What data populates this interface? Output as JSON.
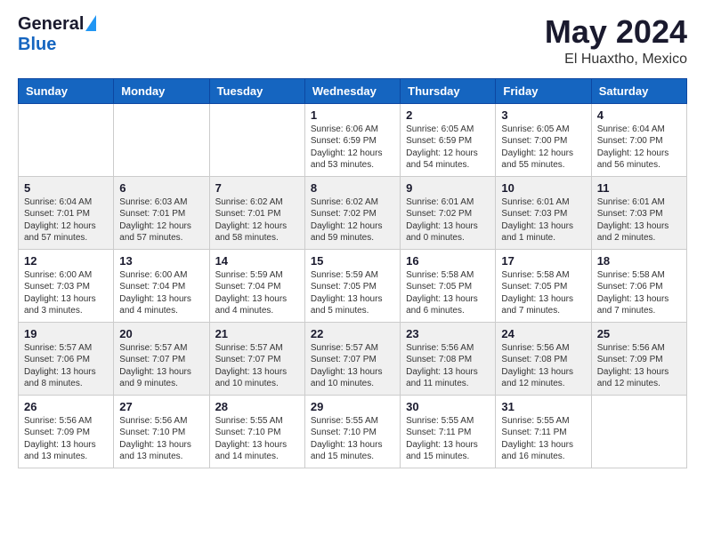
{
  "logo": {
    "general": "General",
    "blue": "Blue"
  },
  "header": {
    "month_year": "May 2024",
    "location": "El Huaxtho, Mexico"
  },
  "days_of_week": [
    "Sunday",
    "Monday",
    "Tuesday",
    "Wednesday",
    "Thursday",
    "Friday",
    "Saturday"
  ],
  "weeks": [
    [
      {
        "day": null,
        "info": ""
      },
      {
        "day": null,
        "info": ""
      },
      {
        "day": null,
        "info": ""
      },
      {
        "day": "1",
        "info": "Sunrise: 6:06 AM\nSunset: 6:59 PM\nDaylight: 12 hours\nand 53 minutes."
      },
      {
        "day": "2",
        "info": "Sunrise: 6:05 AM\nSunset: 6:59 PM\nDaylight: 12 hours\nand 54 minutes."
      },
      {
        "day": "3",
        "info": "Sunrise: 6:05 AM\nSunset: 7:00 PM\nDaylight: 12 hours\nand 55 minutes."
      },
      {
        "day": "4",
        "info": "Sunrise: 6:04 AM\nSunset: 7:00 PM\nDaylight: 12 hours\nand 56 minutes."
      }
    ],
    [
      {
        "day": "5",
        "info": "Sunrise: 6:04 AM\nSunset: 7:01 PM\nDaylight: 12 hours\nand 57 minutes."
      },
      {
        "day": "6",
        "info": "Sunrise: 6:03 AM\nSunset: 7:01 PM\nDaylight: 12 hours\nand 57 minutes."
      },
      {
        "day": "7",
        "info": "Sunrise: 6:02 AM\nSunset: 7:01 PM\nDaylight: 12 hours\nand 58 minutes."
      },
      {
        "day": "8",
        "info": "Sunrise: 6:02 AM\nSunset: 7:02 PM\nDaylight: 12 hours\nand 59 minutes."
      },
      {
        "day": "9",
        "info": "Sunrise: 6:01 AM\nSunset: 7:02 PM\nDaylight: 13 hours\nand 0 minutes."
      },
      {
        "day": "10",
        "info": "Sunrise: 6:01 AM\nSunset: 7:03 PM\nDaylight: 13 hours\nand 1 minute."
      },
      {
        "day": "11",
        "info": "Sunrise: 6:01 AM\nSunset: 7:03 PM\nDaylight: 13 hours\nand 2 minutes."
      }
    ],
    [
      {
        "day": "12",
        "info": "Sunrise: 6:00 AM\nSunset: 7:03 PM\nDaylight: 13 hours\nand 3 minutes."
      },
      {
        "day": "13",
        "info": "Sunrise: 6:00 AM\nSunset: 7:04 PM\nDaylight: 13 hours\nand 4 minutes."
      },
      {
        "day": "14",
        "info": "Sunrise: 5:59 AM\nSunset: 7:04 PM\nDaylight: 13 hours\nand 4 minutes."
      },
      {
        "day": "15",
        "info": "Sunrise: 5:59 AM\nSunset: 7:05 PM\nDaylight: 13 hours\nand 5 minutes."
      },
      {
        "day": "16",
        "info": "Sunrise: 5:58 AM\nSunset: 7:05 PM\nDaylight: 13 hours\nand 6 minutes."
      },
      {
        "day": "17",
        "info": "Sunrise: 5:58 AM\nSunset: 7:05 PM\nDaylight: 13 hours\nand 7 minutes."
      },
      {
        "day": "18",
        "info": "Sunrise: 5:58 AM\nSunset: 7:06 PM\nDaylight: 13 hours\nand 7 minutes."
      }
    ],
    [
      {
        "day": "19",
        "info": "Sunrise: 5:57 AM\nSunset: 7:06 PM\nDaylight: 13 hours\nand 8 minutes."
      },
      {
        "day": "20",
        "info": "Sunrise: 5:57 AM\nSunset: 7:07 PM\nDaylight: 13 hours\nand 9 minutes."
      },
      {
        "day": "21",
        "info": "Sunrise: 5:57 AM\nSunset: 7:07 PM\nDaylight: 13 hours\nand 10 minutes."
      },
      {
        "day": "22",
        "info": "Sunrise: 5:57 AM\nSunset: 7:07 PM\nDaylight: 13 hours\nand 10 minutes."
      },
      {
        "day": "23",
        "info": "Sunrise: 5:56 AM\nSunset: 7:08 PM\nDaylight: 13 hours\nand 11 minutes."
      },
      {
        "day": "24",
        "info": "Sunrise: 5:56 AM\nSunset: 7:08 PM\nDaylight: 13 hours\nand 12 minutes."
      },
      {
        "day": "25",
        "info": "Sunrise: 5:56 AM\nSunset: 7:09 PM\nDaylight: 13 hours\nand 12 minutes."
      }
    ],
    [
      {
        "day": "26",
        "info": "Sunrise: 5:56 AM\nSunset: 7:09 PM\nDaylight: 13 hours\nand 13 minutes."
      },
      {
        "day": "27",
        "info": "Sunrise: 5:56 AM\nSunset: 7:10 PM\nDaylight: 13 hours\nand 13 minutes."
      },
      {
        "day": "28",
        "info": "Sunrise: 5:55 AM\nSunset: 7:10 PM\nDaylight: 13 hours\nand 14 minutes."
      },
      {
        "day": "29",
        "info": "Sunrise: 5:55 AM\nSunset: 7:10 PM\nDaylight: 13 hours\nand 15 minutes."
      },
      {
        "day": "30",
        "info": "Sunrise: 5:55 AM\nSunset: 7:11 PM\nDaylight: 13 hours\nand 15 minutes."
      },
      {
        "day": "31",
        "info": "Sunrise: 5:55 AM\nSunset: 7:11 PM\nDaylight: 13 hours\nand 16 minutes."
      },
      {
        "day": null,
        "info": ""
      }
    ]
  ]
}
